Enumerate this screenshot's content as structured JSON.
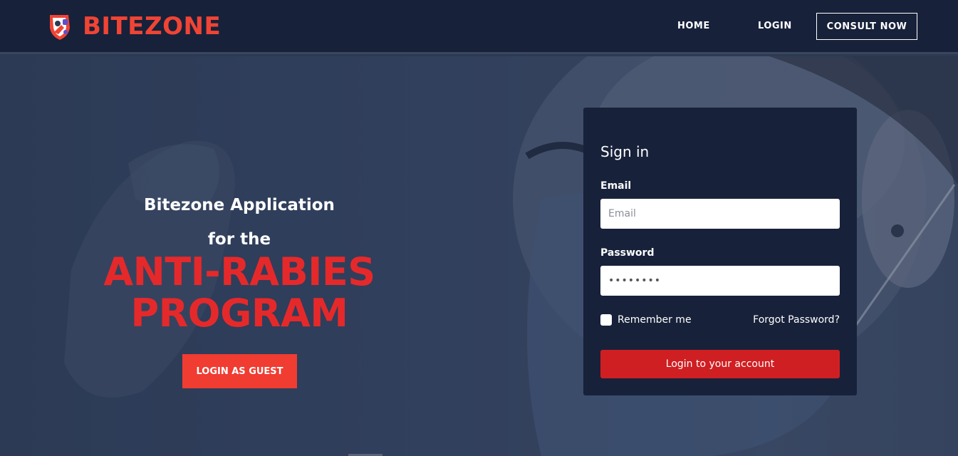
{
  "brand": {
    "name": "BITEZONE",
    "logo_icon": "bitezone-logo-icon",
    "accent_color": "#f04434"
  },
  "nav": {
    "home": "HOME",
    "login": "LOGIN",
    "consult": "CONSULT NOW"
  },
  "hero": {
    "line1": "Bitezone Application",
    "line2": "for the",
    "headline1": "ANTI-RABIES",
    "headline2": "PROGRAM",
    "guest_button": "LOGIN AS GUEST"
  },
  "signin": {
    "title": "Sign in",
    "email_label": "Email",
    "email_placeholder": "Email",
    "email_value": "",
    "password_label": "Password",
    "password_value": "••••••••",
    "remember_label": "Remember me",
    "remember_checked": false,
    "forgot_link": "Forgot Password?",
    "submit": "Login to your account"
  },
  "colors": {
    "navbar": "#17213a",
    "card": "#17213a",
    "headline": "#e5292b",
    "guest_button": "#f03c31",
    "submit_button": "#cf1f22"
  }
}
